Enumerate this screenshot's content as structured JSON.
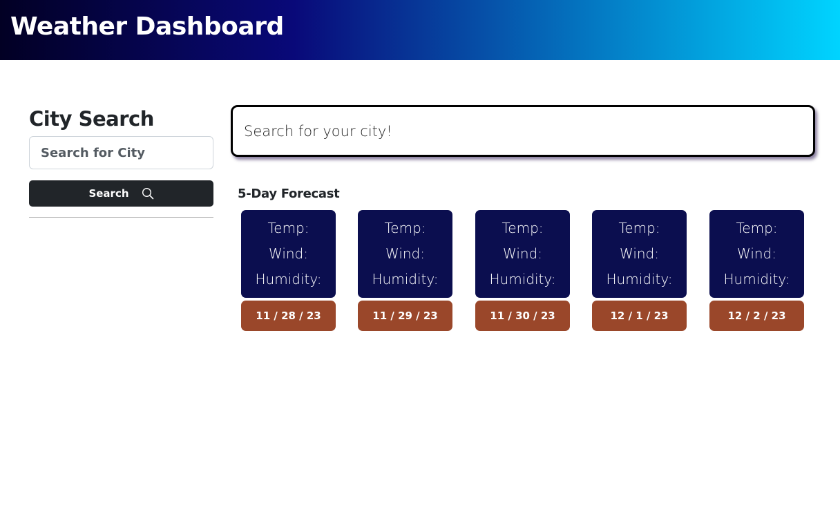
{
  "header": {
    "title": "Weather Dashboard"
  },
  "sidebar": {
    "heading": "City Search",
    "input_placeholder": "Search for City",
    "search_label": "Search"
  },
  "current": {
    "placeholder_text": "Search for your city!"
  },
  "forecast": {
    "title": "5-Day Forecast",
    "labels": {
      "temp": "Temp:",
      "wind": "Wind:",
      "humidity": "Humidity:"
    },
    "days": [
      {
        "date": "11 / 28 / 23"
      },
      {
        "date": "11 / 29 / 23"
      },
      {
        "date": "11 / 30 / 23"
      },
      {
        "date": "12 / 1 / 23"
      },
      {
        "date": "12 / 2 / 23"
      }
    ]
  },
  "colors": {
    "header_gradient": [
      "#020024",
      "#090979",
      "#00d4ff"
    ],
    "card_bg": "#0b0e4f",
    "date_bg": "#9a472a",
    "button_bg": "#212529"
  },
  "icons": {
    "search_button": "search-icon"
  }
}
